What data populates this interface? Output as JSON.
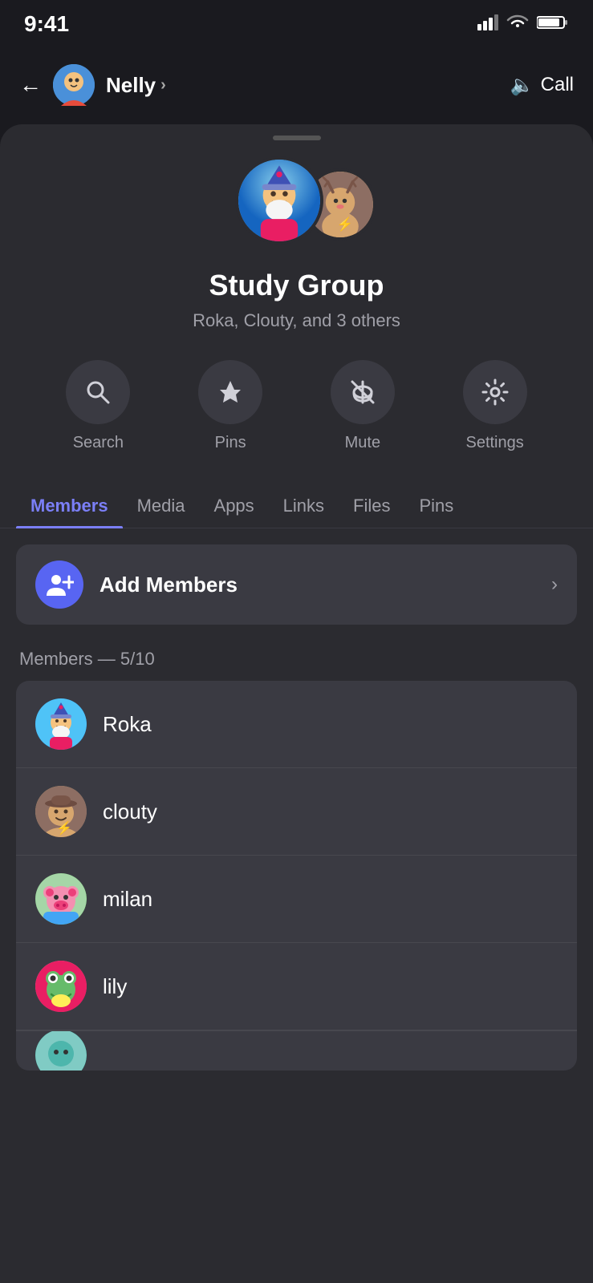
{
  "statusBar": {
    "time": "9:41",
    "signalIcon": "signal",
    "wifiIcon": "wifi",
    "batteryIcon": "battery"
  },
  "topNav": {
    "backLabel": "←",
    "userName": "Nelly",
    "chevron": "›",
    "callLabel": "Call",
    "callIcon": "🔈"
  },
  "groupInfo": {
    "name": "Study Group",
    "membersText": "Roka, Clouty, and 3 others"
  },
  "actionButtons": [
    {
      "id": "search",
      "icon": "🔍",
      "label": "Search"
    },
    {
      "id": "pins",
      "icon": "📌",
      "label": "Pins"
    },
    {
      "id": "mute",
      "icon": "🔕",
      "label": "Mute"
    },
    {
      "id": "settings",
      "icon": "⚙️",
      "label": "Settings"
    }
  ],
  "tabs": [
    {
      "id": "members",
      "label": "Members",
      "active": true
    },
    {
      "id": "media",
      "label": "Media",
      "active": false
    },
    {
      "id": "apps",
      "label": "Apps",
      "active": false
    },
    {
      "id": "links",
      "label": "Links",
      "active": false
    },
    {
      "id": "files",
      "label": "Files",
      "active": false
    },
    {
      "id": "pins",
      "label": "Pins",
      "active": false
    }
  ],
  "addMembers": {
    "label": "Add Members",
    "chevron": "›"
  },
  "membersSection": {
    "countLabel": "Members — 5/10",
    "members": [
      {
        "id": "roka",
        "name": "Roka",
        "avatarClass": "av-roka",
        "emoji": "🧙"
      },
      {
        "id": "clouty",
        "name": "clouty",
        "avatarClass": "av-clouty",
        "emoji": "🤠"
      },
      {
        "id": "milan",
        "name": "milan",
        "avatarClass": "av-milan",
        "emoji": "🐷"
      },
      {
        "id": "lily",
        "name": "lily",
        "avatarClass": "av-lily",
        "emoji": "🐸"
      },
      {
        "id": "extra",
        "name": "",
        "avatarClass": "av-extra",
        "emoji": "🎭"
      }
    ]
  }
}
